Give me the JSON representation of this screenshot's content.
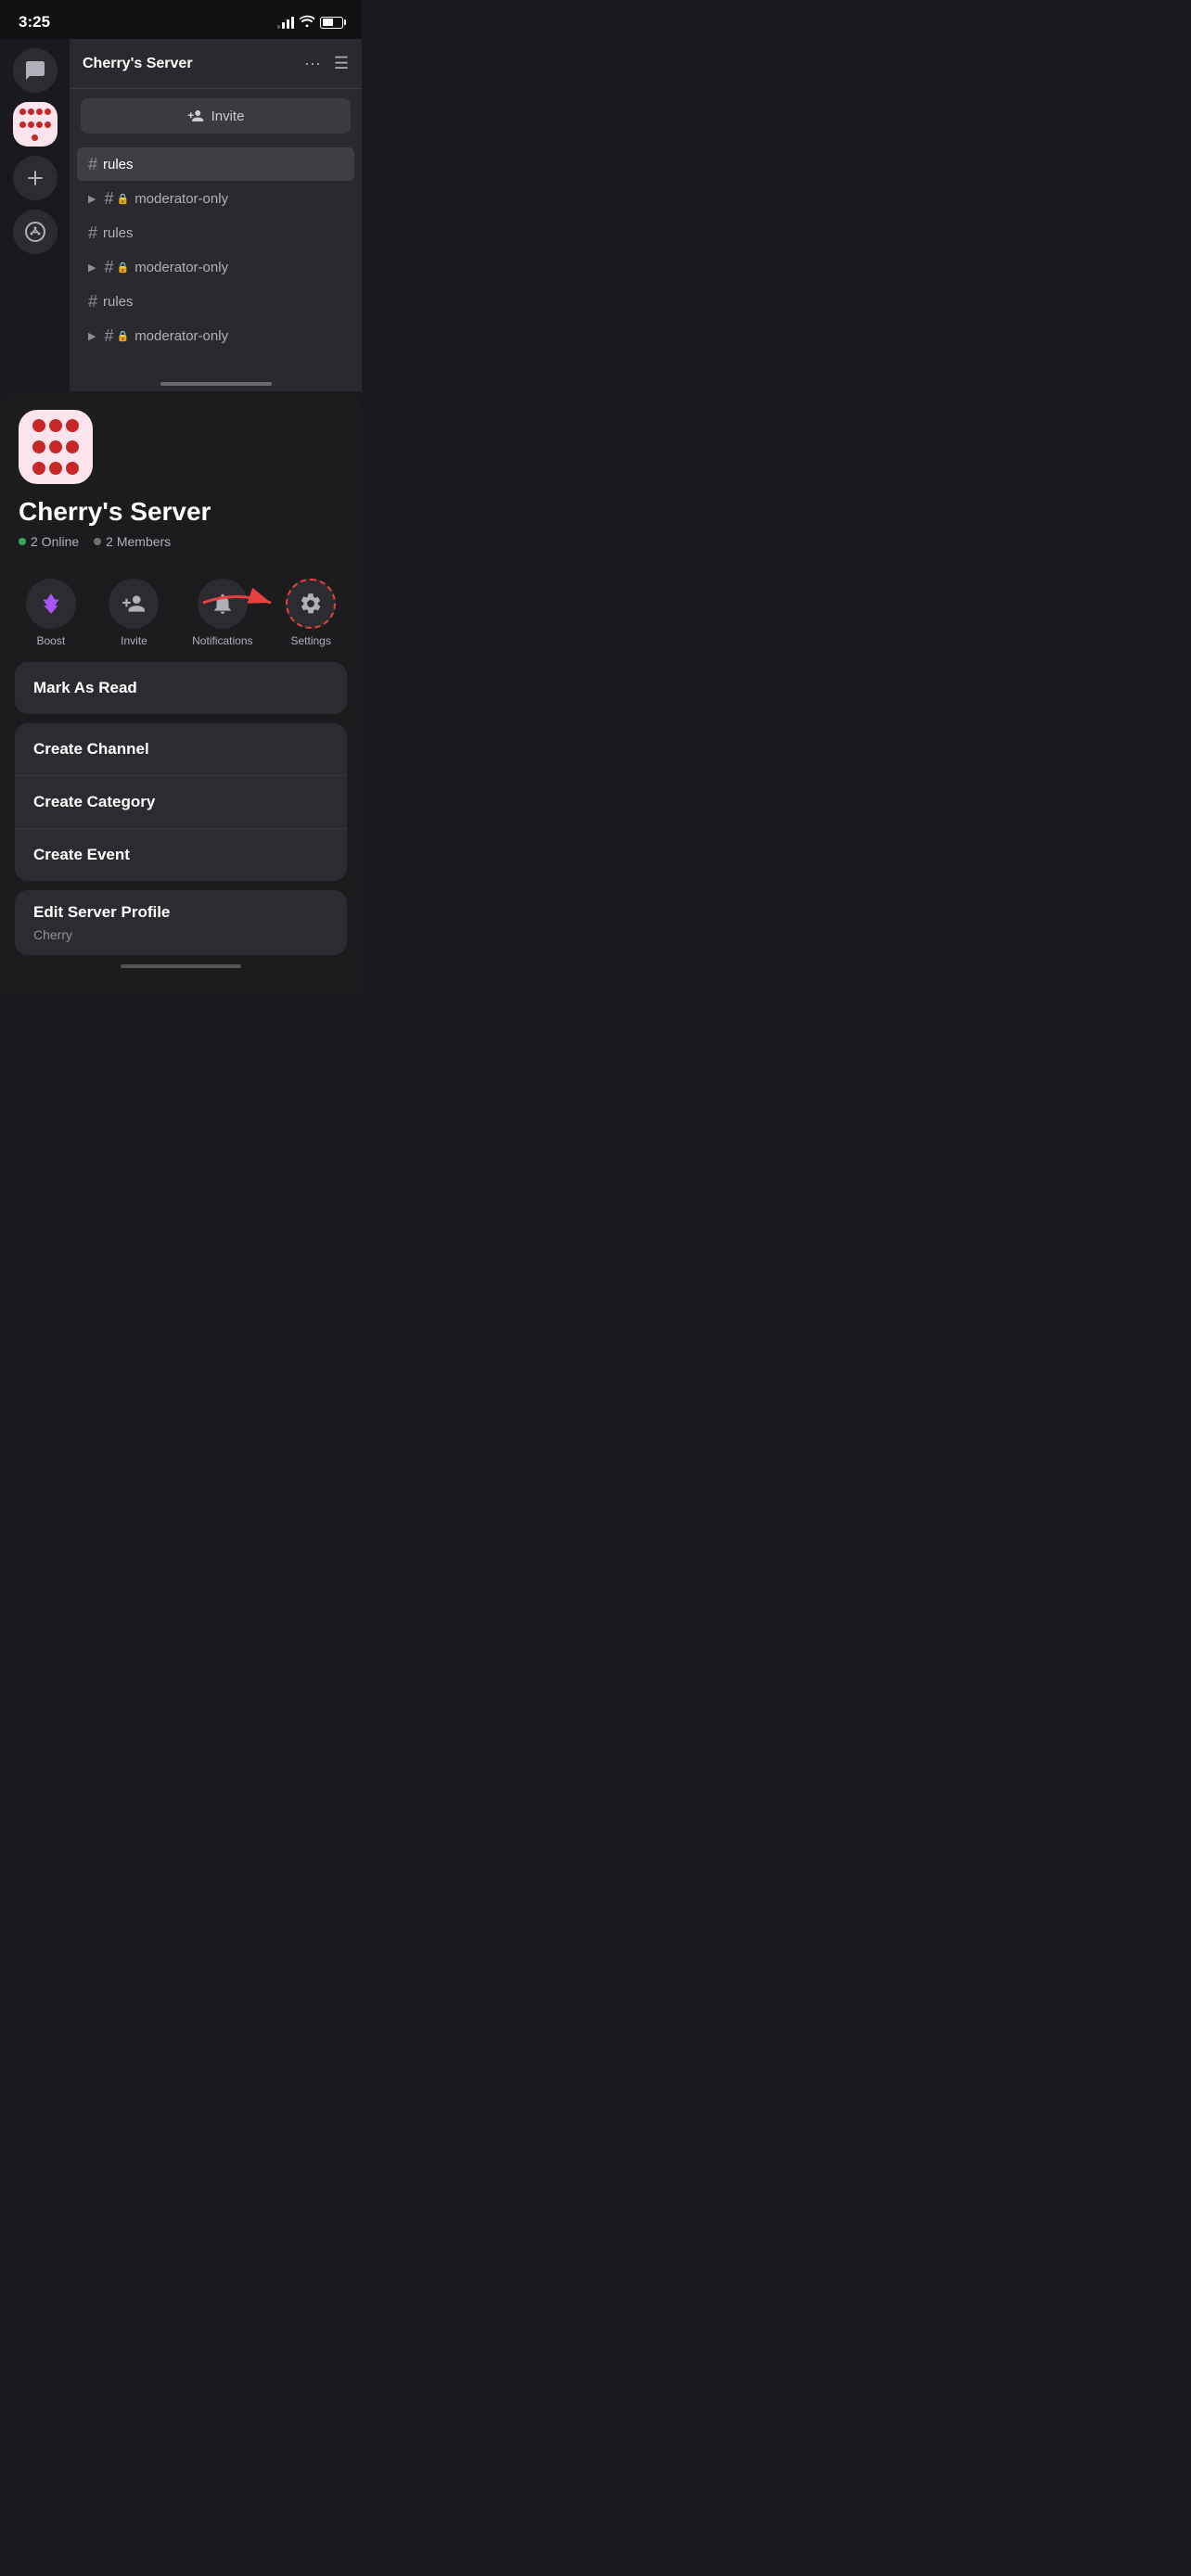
{
  "statusBar": {
    "time": "3:25"
  },
  "sidebar": {
    "icons": [
      {
        "name": "chat",
        "label": "Direct Messages"
      },
      {
        "name": "server-cherry",
        "label": "Cherry's Server"
      },
      {
        "name": "add-server",
        "label": "Add Server"
      },
      {
        "name": "discover",
        "label": "Discover"
      }
    ]
  },
  "serverHeader": {
    "name": "Cherry's Server",
    "inviteLabel": "Invite"
  },
  "channels": [
    {
      "type": "text",
      "name": "rules",
      "locked": false,
      "active": true
    },
    {
      "type": "text",
      "name": "moderator-only",
      "locked": true,
      "active": false,
      "hasArrow": true
    },
    {
      "type": "text",
      "name": "rules",
      "locked": false,
      "active": false
    },
    {
      "type": "text",
      "name": "moderator-only",
      "locked": true,
      "active": false,
      "hasArrow": true
    },
    {
      "type": "text",
      "name": "rules",
      "locked": false,
      "active": false
    },
    {
      "type": "text",
      "name": "moderator-only",
      "locked": true,
      "active": false,
      "hasArrow": true
    }
  ],
  "serverInfo": {
    "name": "Cherry's Server",
    "onlineCount": "2 Online",
    "memberCount": "2 Members"
  },
  "actions": [
    {
      "id": "boost",
      "label": "Boost"
    },
    {
      "id": "invite",
      "label": "Invite"
    },
    {
      "id": "notifications",
      "label": "Notifications"
    },
    {
      "id": "settings",
      "label": "Settings"
    }
  ],
  "menuItems": {
    "markAsRead": "Mark As Read",
    "createChannel": "Create Channel",
    "createCategory": "Create Category",
    "createEvent": "Create Event",
    "editProfile": "Edit Server Profile",
    "editProfileSub": "Cherry"
  }
}
